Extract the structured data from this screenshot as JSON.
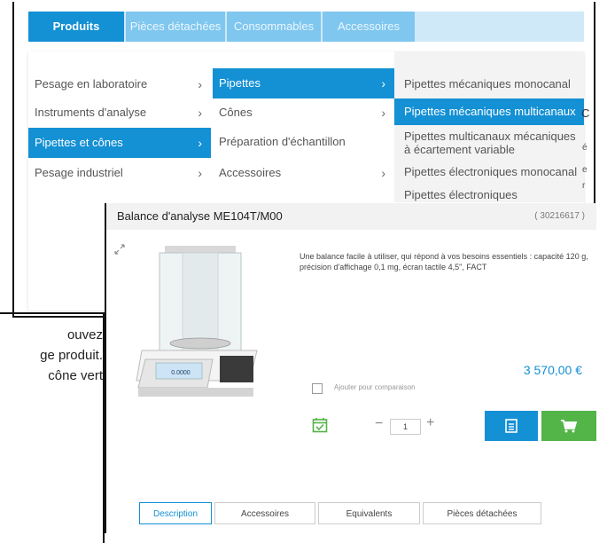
{
  "nav": {
    "tabs": [
      {
        "label": "Produits"
      },
      {
        "label": "Pièces détachées"
      },
      {
        "label": "Consommables"
      },
      {
        "label": "Accessoires"
      }
    ]
  },
  "menu": {
    "col1": [
      {
        "label": "Pesage en laboratoire"
      },
      {
        "label": "Instruments d'analyse"
      },
      {
        "label": "Pipettes et cônes"
      },
      {
        "label": "Pesage industriel"
      }
    ],
    "col2": [
      {
        "label": "Pipettes"
      },
      {
        "label": "Cônes"
      },
      {
        "label": "Préparation d'échantillon"
      },
      {
        "label": "Accessoires"
      }
    ],
    "col3": [
      {
        "label": "Pipettes mécaniques monocanal"
      },
      {
        "label": "Pipettes mécaniques multicanaux"
      },
      {
        "label_line1": "Pipettes multicanaux mécaniques",
        "label_line2": "à écartement variable"
      },
      {
        "label": "Pipettes électroniques monocanal"
      },
      {
        "label": "Pipettes électroniques"
      }
    ],
    "col3_overflow": [
      "C",
      "é",
      "e",
      "r"
    ]
  },
  "background_text": {
    "lines": [
      "ouvez",
      "ge produit.",
      "cône vert"
    ]
  },
  "product": {
    "title": "Balance d'analyse ME104T/M00",
    "ref": "( 30216617 )",
    "description": "Une balance facile à utiliser, qui répond à vos besoins essentiels : capacité 120 g, précision d'affichage 0,1 mg, écran tactile 4,5\", FACT",
    "price": "3 570,00 €",
    "compare_label": "Ajouter pour comparaison",
    "quantity": "1",
    "display_value": "0.0000",
    "tabs": [
      {
        "label": "Description"
      },
      {
        "label": "Accessoires"
      },
      {
        "label": "Equivalents"
      },
      {
        "label": "Pièces détachées"
      }
    ]
  },
  "colors": {
    "primary": "#1490d4",
    "tab_inactive": "#7fc7ef",
    "cart_green": "#53b448",
    "calendar_green": "#53b448"
  }
}
